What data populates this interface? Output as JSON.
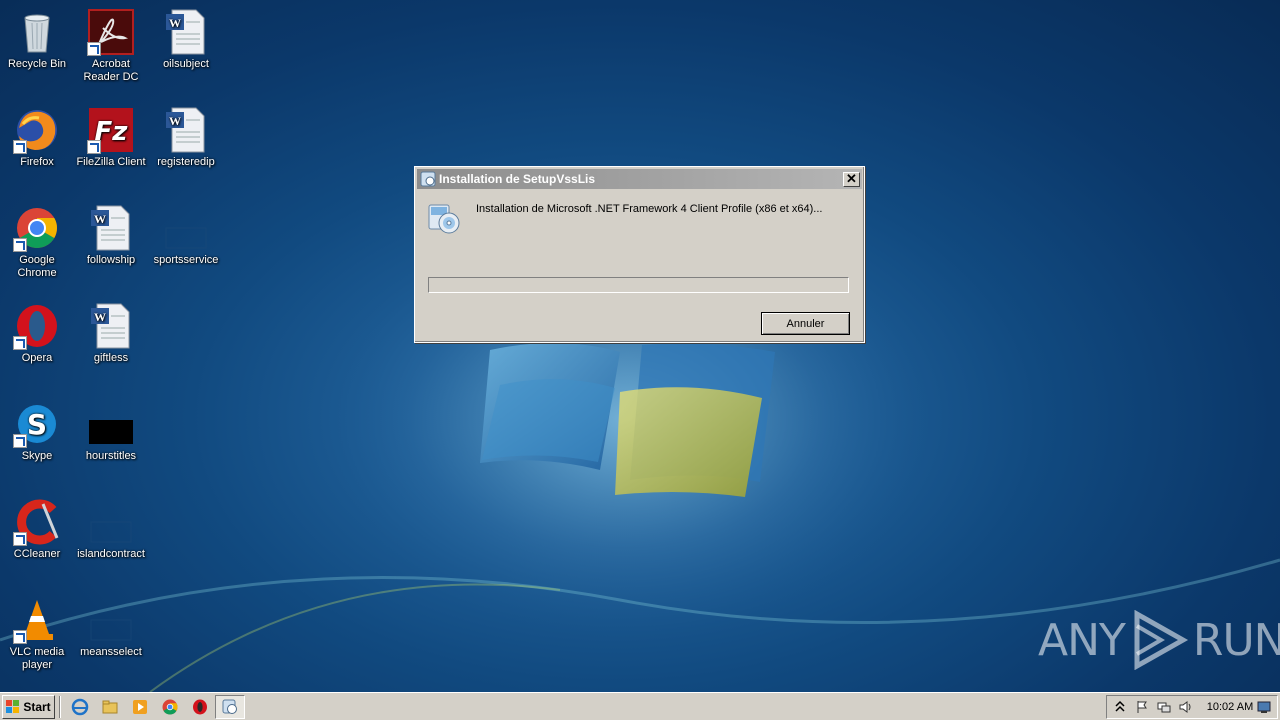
{
  "desktop": {
    "icons": [
      {
        "label": "Recycle Bin",
        "icon": "recycle-bin-icon"
      },
      {
        "label": "Acrobat Reader DC",
        "icon": "acrobat-icon"
      },
      {
        "label": "oilsubject",
        "icon": "word-document-icon"
      },
      {
        "label": "Firefox",
        "icon": "firefox-icon"
      },
      {
        "label": "FileZilla Client",
        "icon": "filezilla-icon"
      },
      {
        "label": "registeredip",
        "icon": "word-document-icon"
      },
      {
        "label": "Google Chrome",
        "icon": "chrome-icon"
      },
      {
        "label": "followship",
        "icon": "word-document-icon"
      },
      {
        "label": "sportsservice",
        "icon": "blank-file-icon"
      },
      {
        "label": "Opera",
        "icon": "opera-icon"
      },
      {
        "label": "giftless",
        "icon": "word-document-icon"
      },
      {
        "label": "Skype",
        "icon": "skype-icon"
      },
      {
        "label": "hourstitles",
        "icon": "black-file-icon"
      },
      {
        "label": "CCleaner",
        "icon": "ccleaner-icon"
      },
      {
        "label": "islandcontract",
        "icon": "blank-file-icon"
      },
      {
        "label": "VLC media player",
        "icon": "vlc-icon"
      },
      {
        "label": "meansselect",
        "icon": "blank-file-icon"
      }
    ]
  },
  "dialog": {
    "title": "Installation de SetupVssLis",
    "message": "Installation de Microsoft .NET Framework 4 Client Profile (x86 et x64)...",
    "progress": 0,
    "cancel_label": "Annuler",
    "close_glyph": "✕"
  },
  "watermark": {
    "left": "ANY",
    "right": "RUN"
  },
  "taskbar": {
    "start_label": "Start",
    "quick_launch": [
      "ie-icon",
      "explorer-icon",
      "media-player-icon",
      "chrome-icon",
      "opera-icon",
      "setup-icon"
    ],
    "clock": "10:02 AM"
  }
}
